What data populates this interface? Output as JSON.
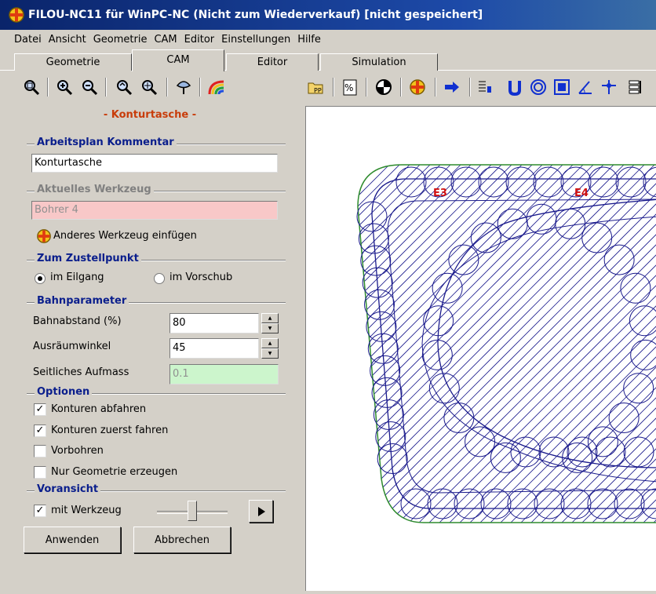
{
  "window": {
    "title": "FILOU-NC11 für WinPC-NC (Nicht zum Wiederverkauf)  [nicht gespeichert]"
  },
  "menu": [
    "Datei",
    "Ansicht",
    "Geometrie",
    "CAM",
    "Editor",
    "Einstellungen",
    "Hilfe"
  ],
  "tabs": [
    {
      "label": "Geometrie",
      "active": false
    },
    {
      "label": "CAM",
      "active": true
    },
    {
      "label": "Editor",
      "active": false
    },
    {
      "label": "Simulation",
      "active": false
    }
  ],
  "toolbar": {
    "left_icons": [
      "zoom-fit-icon",
      "zoom-in-icon",
      "zoom-out-icon",
      "zoom-window-icon",
      "pan-zoom-icon",
      "view-icon",
      "rainbow-icon"
    ],
    "right_icons": [
      "postprocessor-icon",
      "percent-icon",
      "drill-icon",
      "tool-icon",
      "run-arrow-icon",
      "list-icon",
      "pocket-icon",
      "circle-icon",
      "frame-icon",
      "angle-icon",
      "plus-icon",
      "stack-icon"
    ]
  },
  "panel": {
    "title": "- Konturtasche -",
    "comment": {
      "heading": "Arbeitsplan Kommentar",
      "value": "Konturtasche"
    },
    "tool": {
      "heading": "Aktuelles Werkzeug",
      "value": "Bohrer 4",
      "insert_label": "Anderes Werkzeug einfügen"
    },
    "approach": {
      "heading": "Zum Zustellpunkt",
      "option_rapid": "im Eilgang",
      "option_feed": "im Vorschub",
      "selected": "im Eilgang"
    },
    "path": {
      "heading": "Bahnparameter",
      "distance_label": "Bahnabstand (%)",
      "distance_value": "80",
      "angle_label": "Ausräumwinkel",
      "angle_value": "45",
      "allowance_label": "Seitliches Aufmass",
      "allowance_value": "0.1"
    },
    "options": {
      "heading": "Optionen",
      "items": [
        {
          "label": "Konturen abfahren",
          "checked": true
        },
        {
          "label": "Konturen zuerst fahren",
          "checked": true
        },
        {
          "label": "Vorbohren",
          "checked": false
        },
        {
          "label": "Nur Geometrie erzeugen",
          "checked": false
        }
      ]
    },
    "preview": {
      "heading": "Voransicht",
      "with_tool_label": "mit Werkzeug",
      "with_tool_checked": true,
      "slider_level": 0.5
    },
    "buttons": {
      "apply": "Anwenden",
      "cancel": "Abbrechen"
    }
  },
  "canvas": {
    "labels": [
      "E3",
      "E4"
    ]
  },
  "colors": {
    "path": "#1a1a8c",
    "contour": "#2e8b2e",
    "label": "#d01010",
    "heading": "#0a1e8c",
    "tool_bg": "#f8c8c8",
    "allowance_bg": "#ccf5cc"
  }
}
